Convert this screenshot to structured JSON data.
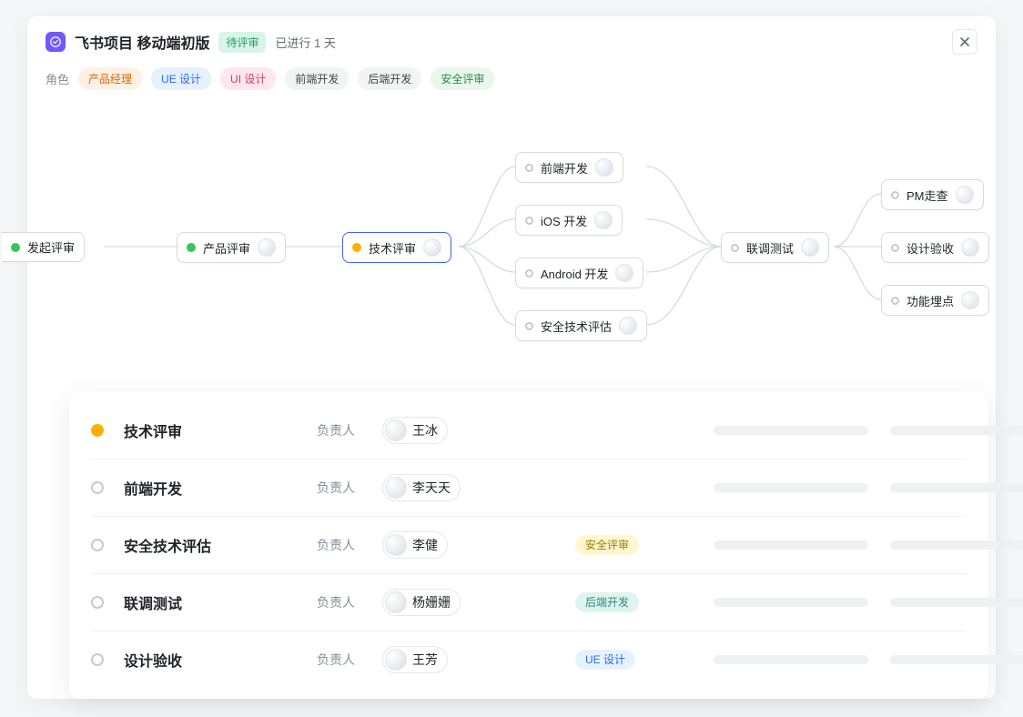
{
  "header": {
    "title": "飞书项目 移动端初版",
    "status": "待评审",
    "elapsed": "已进行 1 天"
  },
  "roles": {
    "label": "角色",
    "items": [
      {
        "label": "产品经理",
        "style": "orange"
      },
      {
        "label": "UE 设计",
        "style": "blue"
      },
      {
        "label": "UI 设计",
        "style": "pink"
      },
      {
        "label": "前端开发",
        "style": "grey"
      },
      {
        "label": "后端开发",
        "style": "grey"
      },
      {
        "label": "安全评审",
        "style": "green"
      }
    ]
  },
  "flow": {
    "nodes": [
      {
        "id": "n0",
        "label": "发起评审",
        "status": "green",
        "avatar": false
      },
      {
        "id": "n1",
        "label": "产品评审",
        "status": "green",
        "avatar": true
      },
      {
        "id": "n2",
        "label": "技术评审",
        "status": "amber",
        "avatar": true,
        "selected": true
      },
      {
        "id": "n3",
        "label": "前端开发",
        "status": "grey",
        "avatar": true
      },
      {
        "id": "n4",
        "label": "iOS 开发",
        "status": "grey",
        "avatar": true
      },
      {
        "id": "n5",
        "label": "Android  开发",
        "status": "grey",
        "avatar": true
      },
      {
        "id": "n6",
        "label": "安全技术评估",
        "status": "grey",
        "avatar": true
      },
      {
        "id": "n7",
        "label": "联调测试",
        "status": "grey",
        "avatar": true
      },
      {
        "id": "n8",
        "label": "PM走查",
        "status": "grey",
        "avatar": true
      },
      {
        "id": "n9",
        "label": "设计验收",
        "status": "grey",
        "avatar": true
      },
      {
        "id": "n10",
        "label": "功能埋点",
        "status": "grey",
        "avatar": true
      }
    ]
  },
  "details": {
    "owner_label": "负责人",
    "rows": [
      {
        "status": "amber",
        "title": "技术评审",
        "owner": "王冰",
        "tag": null
      },
      {
        "status": "grey",
        "title": "前端开发",
        "owner": "李天天",
        "tag": null
      },
      {
        "status": "grey",
        "title": "安全技术评估",
        "owner": "李健",
        "tag": {
          "label": "安全评审",
          "style": "yellow"
        }
      },
      {
        "status": "grey",
        "title": "联调测试",
        "owner": "杨姗姗",
        "tag": {
          "label": "后端开发",
          "style": "teal"
        }
      },
      {
        "status": "grey",
        "title": "设计验收",
        "owner": "王芳",
        "tag": {
          "label": "UE 设计",
          "style": "bluel"
        }
      }
    ]
  }
}
